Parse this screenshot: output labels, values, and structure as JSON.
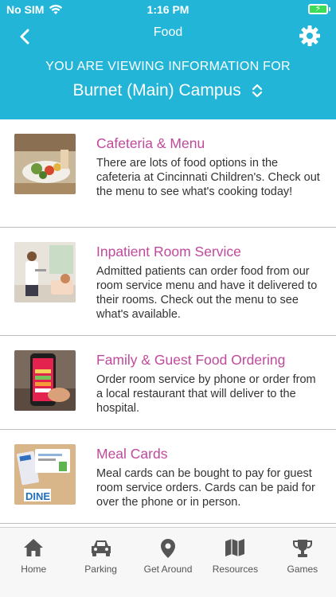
{
  "status": {
    "carrier": "No SIM",
    "time": "1:16 PM"
  },
  "nav": {
    "title": "Food"
  },
  "campus": {
    "viewing_label": "YOU ARE VIEWING INFORMATION FOR",
    "selected": "Burnet (Main) Campus"
  },
  "items": [
    {
      "title": "Cafeteria & Menu",
      "description": "There are lots of food options in the cafeteria at Cincinnati Children's. Check out the menu to see what's cooking today!"
    },
    {
      "title": "Inpatient Room Service",
      "description": "Admitted patients can order food from our room service menu and have it delivered to their rooms. Check out the menu to see what's available."
    },
    {
      "title": "Family & Guest Food Ordering",
      "description": "Order room service by phone or order from a local restaurant that will deliver to the hospital."
    },
    {
      "title": "Meal Cards",
      "description": "Meal cards can be bought to pay for guest room service orders. Cards can be paid for over the phone or in person.",
      "thumb_text": "DINE"
    }
  ],
  "tabs": [
    {
      "label": "Home",
      "icon": "home-icon"
    },
    {
      "label": "Parking",
      "icon": "car-icon"
    },
    {
      "label": "Get Around",
      "icon": "location-pin-icon"
    },
    {
      "label": "Resources",
      "icon": "map-icon"
    },
    {
      "label": "Games",
      "icon": "trophy-icon"
    }
  ],
  "colors": {
    "header_bg": "#22b5d8",
    "title_accent": "#c0499b",
    "battery_fill": "#3ddc5a"
  }
}
